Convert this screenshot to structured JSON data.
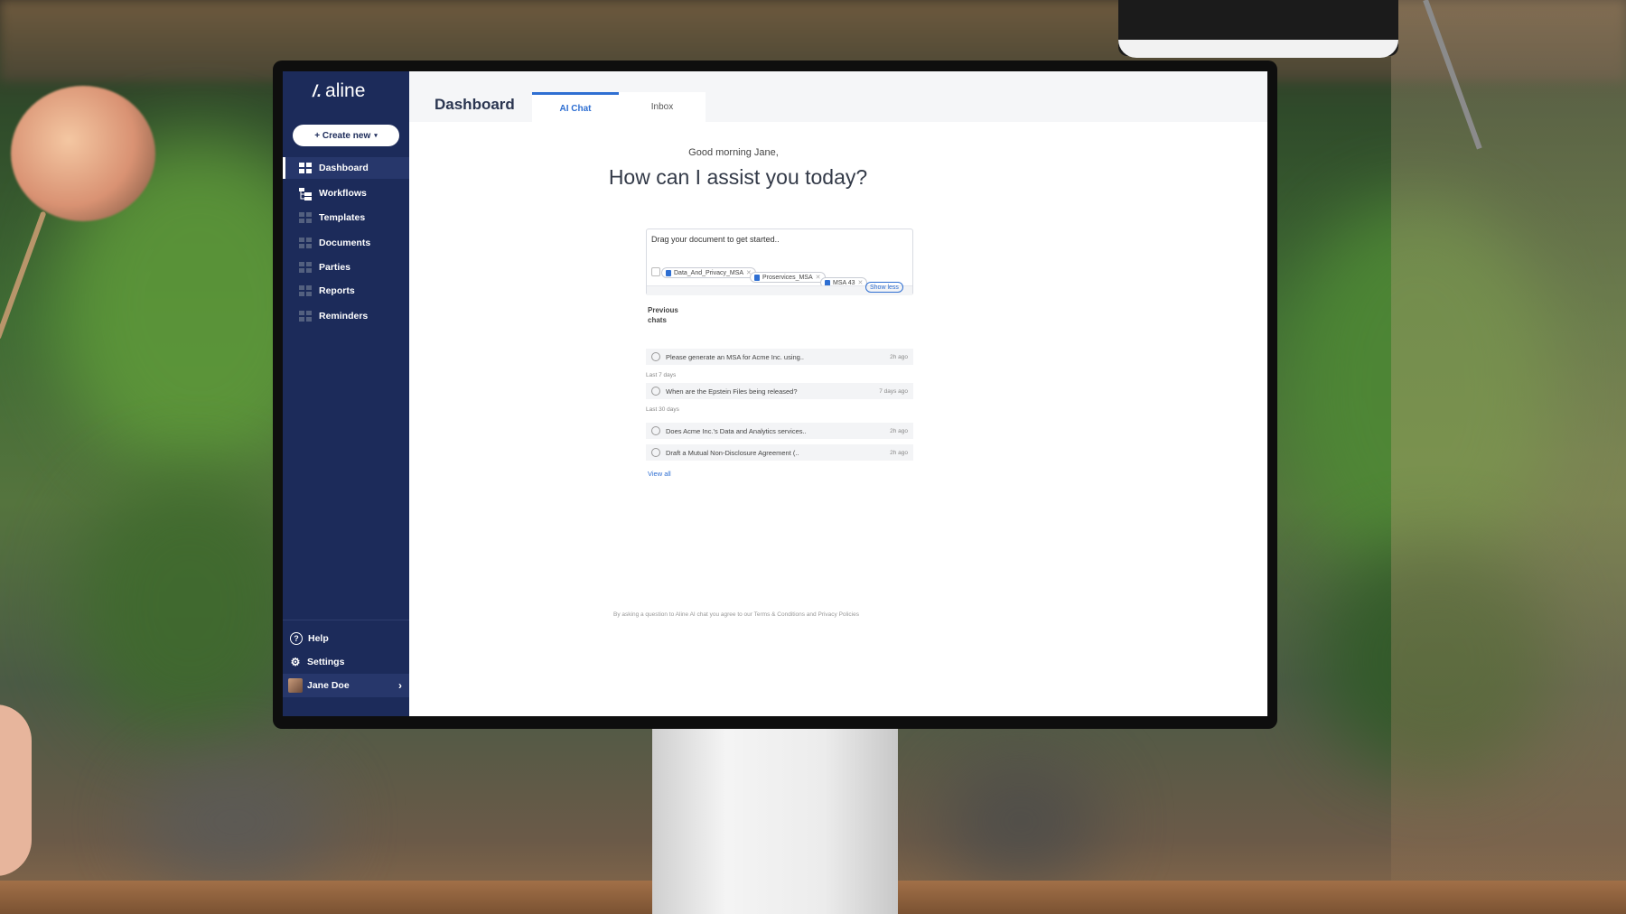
{
  "app": {
    "brand": "aline",
    "brand_mark": "/."
  },
  "sidebar": {
    "create_label": "+ Create new",
    "create_caret": "▾",
    "items": [
      {
        "label": "Dashboard",
        "icon": "dashboard-icon",
        "active": true
      },
      {
        "label": "Workflows",
        "icon": "workflows-icon"
      },
      {
        "label": "Templates",
        "icon": "templates-icon"
      },
      {
        "label": "Documents",
        "icon": "documents-icon"
      },
      {
        "label": "Parties",
        "icon": "parties-icon"
      },
      {
        "label": "Reports",
        "icon": "reports-icon"
      },
      {
        "label": "Reminders",
        "icon": "reminders-icon"
      }
    ],
    "help": "Help",
    "settings": "Settings",
    "user_name": "Jane Doe",
    "help_glyph": "?",
    "settings_glyph": "⚙",
    "user_chevron": "›"
  },
  "header": {
    "title": "Dashboard",
    "tabs": [
      {
        "label": "AI Chat",
        "active": true
      },
      {
        "label": "Inbox"
      }
    ]
  },
  "main": {
    "greeting": "Good morning Jane,",
    "headline": "How can I assist you today?",
    "composer": {
      "placeholder": "Drag your document to get started..",
      "chips": [
        "Data_And_Privacy_MSA",
        "Proservices_MSA",
        "MSA 43"
      ],
      "show_less": "Show less"
    },
    "previous_chats_title": "Previous chats",
    "chats": [
      {
        "text": "Please generate an MSA for Acme Inc. using..",
        "time": "2h ago"
      },
      {
        "group": "Last 7 days"
      },
      {
        "text": "When are the Epstein Files being released?",
        "time": "7 days ago"
      },
      {
        "group": "Last 30 days"
      },
      {
        "text": "Does Acme Inc.'s Data and Analytics services..",
        "time": "2h ago"
      },
      {
        "text": "Draft a Mutual Non-Disclosure Agreement (..",
        "time": "2h ago"
      }
    ],
    "view_all": "View all",
    "footer": "By asking a question to Aline AI chat you agree to our Terms & Conditions and Privacy Policies"
  },
  "colors": {
    "sidebar_bg": "#1c2b5a",
    "accent": "#2f6fd2"
  }
}
